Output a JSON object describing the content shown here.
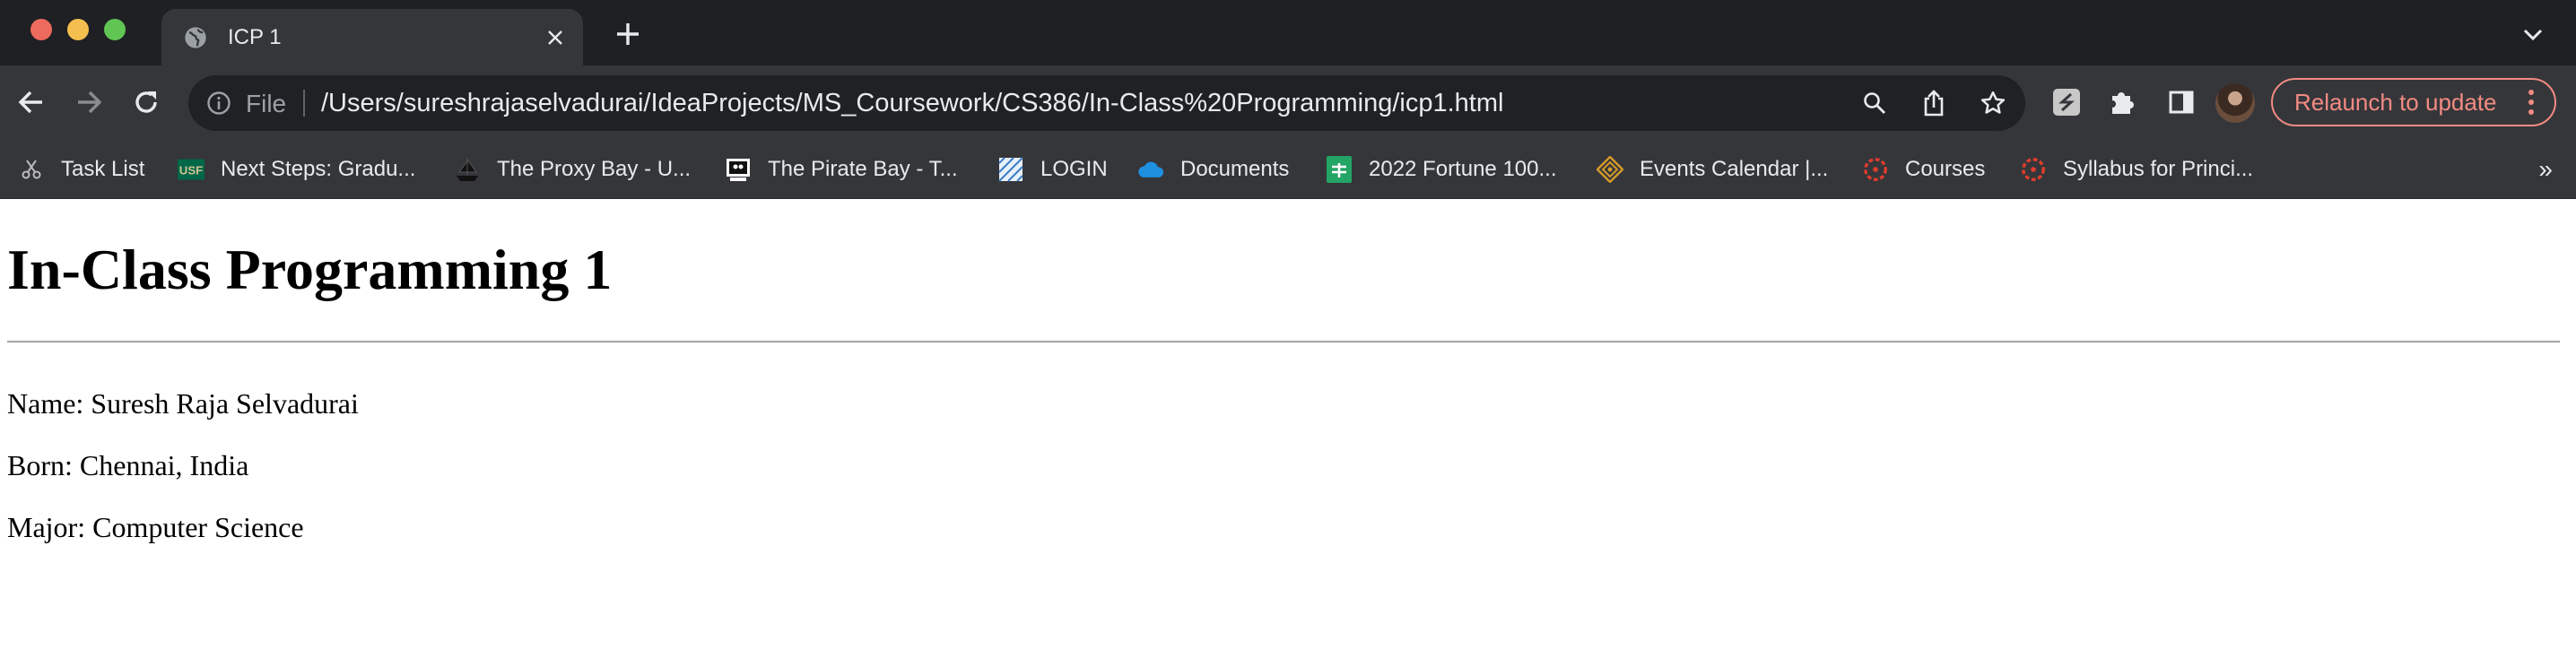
{
  "browser": {
    "tab": {
      "title": "ICP 1"
    },
    "omnibox": {
      "scheme_label": "File",
      "url": "/Users/sureshrajaselvadurai/IdeaProjects/MS_Coursework/CS386/In-Class%20Programming/icp1.html"
    },
    "relaunch_label": "Relaunch to update",
    "bookmarks": [
      {
        "label": "Task List",
        "icon": "scissors-icon"
      },
      {
        "label": "Next Steps: Gradu...",
        "icon": "usf-logo-icon"
      },
      {
        "label": "The Proxy Bay - U...",
        "icon": "ship-icon"
      },
      {
        "label": "The Pirate Bay - T...",
        "icon": "pirate-bay-icon"
      },
      {
        "label": "LOGIN",
        "icon": "login-favicon-icon"
      },
      {
        "label": "Documents",
        "icon": "cloud-icon"
      },
      {
        "label": "2022 Fortune 100...",
        "icon": "sheets-icon"
      },
      {
        "label": "Events Calendar |...",
        "icon": "diamond-icon"
      },
      {
        "label": "Courses",
        "icon": "canvas-icon"
      },
      {
        "label": "Syllabus for Princi...",
        "icon": "canvas-icon"
      }
    ],
    "bookmarks_overflow": "»"
  },
  "page": {
    "heading": "In-Class Programming 1",
    "lines": [
      "Name: Suresh Raja Selvadurai",
      "Born: Chennai, India",
      "Major: Computer Science"
    ]
  },
  "colors": {
    "titlebar": "#1f2023",
    "toolbar": "#35363a",
    "omnibox": "#202124",
    "relaunch_accent": "#f28b82"
  }
}
